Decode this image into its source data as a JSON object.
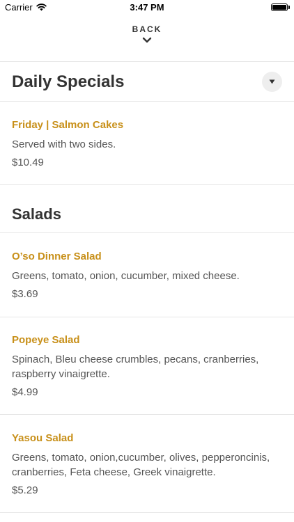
{
  "status_bar": {
    "carrier": "Carrier",
    "time": "3:47 PM"
  },
  "nav": {
    "back_label": "BACK"
  },
  "sections": [
    {
      "title": "Daily Specials",
      "items": [
        {
          "name": "Friday | Salmon Cakes",
          "description": "Served with two sides.",
          "price": "$10.49"
        }
      ]
    },
    {
      "title": "Salads",
      "items": [
        {
          "name": "O’so Dinner Salad",
          "description": "Greens, tomato, onion, cucumber, mixed cheese.",
          "price": "$3.69"
        },
        {
          "name": "Popeye Salad",
          "description": "Spinach, Bleu cheese crumbles, pecans, cranberries, raspberry vinaigrette.",
          "price": "$4.99"
        },
        {
          "name": "Yasou Salad",
          "description": "Greens, tomato, onion,cucumber, olives, pepperoncinis, cranberries, Feta cheese, Greek vinaigrette.",
          "price": "$5.29"
        }
      ]
    }
  ],
  "colors": {
    "item_name": "#c8901a",
    "divider": "#e6e6e6",
    "text": "#333333"
  }
}
